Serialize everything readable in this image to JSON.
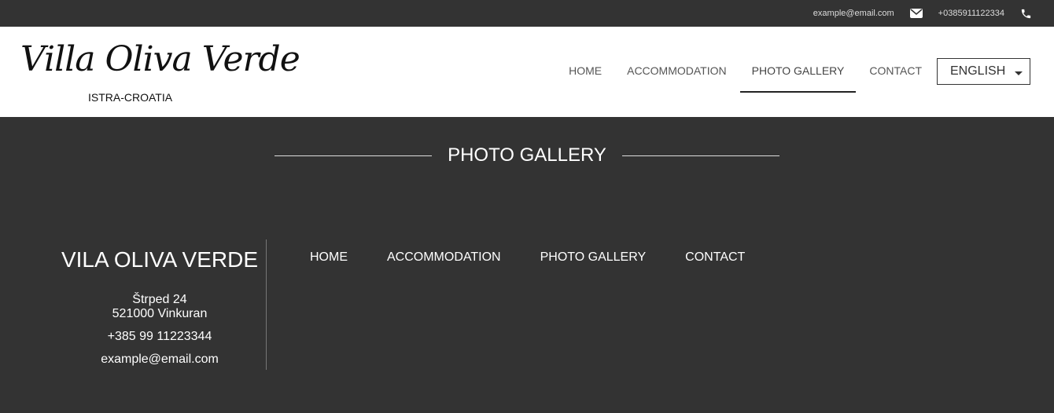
{
  "topbar": {
    "email": "example@email.com",
    "phone": "+0385911122334",
    "mail_icon": "envelope-icon",
    "phone_icon": "phone-icon"
  },
  "header": {
    "logo_title": "Villa Oliva Verde",
    "logo_subtitle": "ISTRA-CROATIA",
    "nav": [
      {
        "label": "HOME",
        "active": false
      },
      {
        "label": "ACCOMMODATION",
        "active": false
      },
      {
        "label": "PHOTO GALLERY",
        "active": true
      },
      {
        "label": "CONTACT",
        "active": false
      }
    ],
    "language": "ENGLISH"
  },
  "main": {
    "title": "PHOTO GALLERY"
  },
  "footer": {
    "name": "VILA OLIVA VERDE",
    "address_line1": "Štrped 24",
    "address_line2": "521000 Vinkuran",
    "phone": "+385 99 11223344",
    "email": "example@email.com",
    "nav": [
      "HOME",
      "ACCOMMODATION",
      "PHOTO GALLERY",
      "CONTACT"
    ]
  },
  "colors": {
    "dark_background": "#333333",
    "header_background": "#ffffff"
  }
}
